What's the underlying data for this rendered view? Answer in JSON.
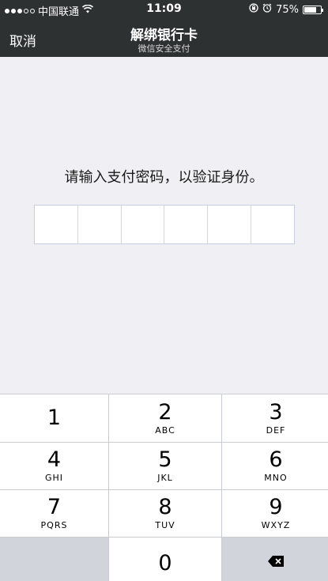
{
  "status_bar": {
    "carrier": "中国联通",
    "time": "11:09",
    "battery": "75%",
    "battery_level": 0.75
  },
  "nav": {
    "cancel": "取消",
    "title": "解绑银行卡",
    "subtitle": "微信安全支付"
  },
  "prompt": "请输入支付密码，以验证身份。",
  "pin": {
    "length": 6
  },
  "keypad": {
    "keys": [
      {
        "num": "1",
        "letters": ""
      },
      {
        "num": "2",
        "letters": "ABC"
      },
      {
        "num": "3",
        "letters": "DEF"
      },
      {
        "num": "4",
        "letters": "GHI"
      },
      {
        "num": "5",
        "letters": "JKL"
      },
      {
        "num": "6",
        "letters": "MNO"
      },
      {
        "num": "7",
        "letters": "PQRS"
      },
      {
        "num": "8",
        "letters": "TUV"
      },
      {
        "num": "9",
        "letters": "WXYZ"
      },
      {
        "num": "0",
        "letters": ""
      }
    ]
  },
  "icons": {
    "wifi": "wifi-icon",
    "lock": "rotation-lock-icon",
    "alarm": "alarm-icon",
    "delete": "backspace-icon"
  }
}
